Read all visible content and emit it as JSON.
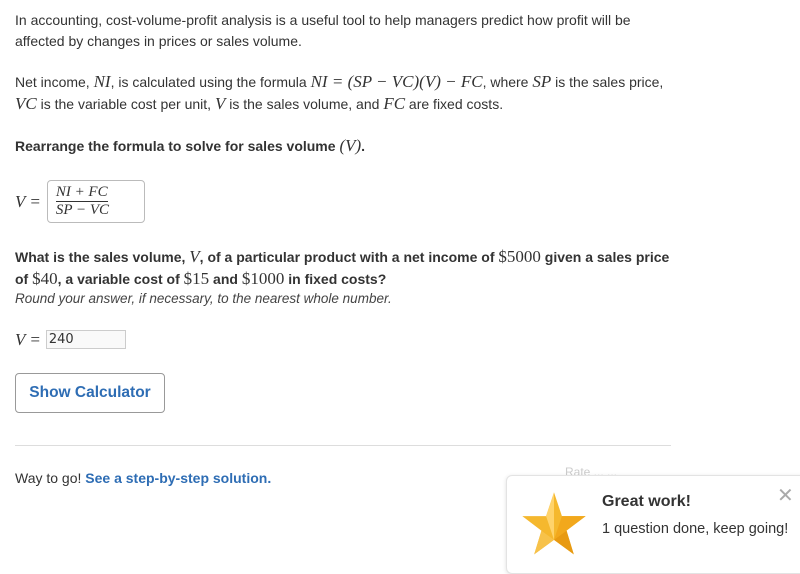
{
  "intro": {
    "text": "In accounting, cost-volume-profit analysis is a useful tool to help managers predict how profit will be affected by changes in prices or sales volume."
  },
  "definition": {
    "t1": "Net income, ",
    "NI": "NI",
    "t2": ", is calculated using the formula ",
    "formula": "NI = (SP − VC)(V) − FC",
    "t3": ", where ",
    "SP": "SP",
    "t4": " is the sales price, ",
    "VC": "VC",
    "t5": " is the variable cost per unit, ",
    "V": "V",
    "t6": " is the sales volume, and ",
    "FC": "FC",
    "t7": " are fixed costs."
  },
  "rearrange": {
    "text": "Rearrange the formula to solve for sales volume ",
    "var": "(V)",
    "end": "."
  },
  "formula_answer": {
    "lhs": "V =",
    "numerator": "NI + FC",
    "denominator": "SP − VC"
  },
  "question": {
    "t1": "What is the sales volume, ",
    "V": "V",
    "t2": ", of a particular product with a net income of ",
    "ni": "$5000",
    "t3": " given a sales price of ",
    "sp": "$40",
    "t4": ", a variable cost of ",
    "vc": "$15",
    "t5": " and ",
    "fc": "$1000",
    "t6": " in fixed costs?",
    "instruction": "Round your answer, if necessary, to the nearest whole number."
  },
  "answer": {
    "lhs": "V =",
    "value": "240"
  },
  "calculator_button": "Show Calculator",
  "feedback": {
    "text": "Way to go! ",
    "link": "See a step-by-step solution."
  },
  "rate_text": "Rate ... ...",
  "toast": {
    "title": "Great work!",
    "message": "1 question done, keep going!",
    "close": "✕",
    "star_color": "#f5b82e"
  }
}
